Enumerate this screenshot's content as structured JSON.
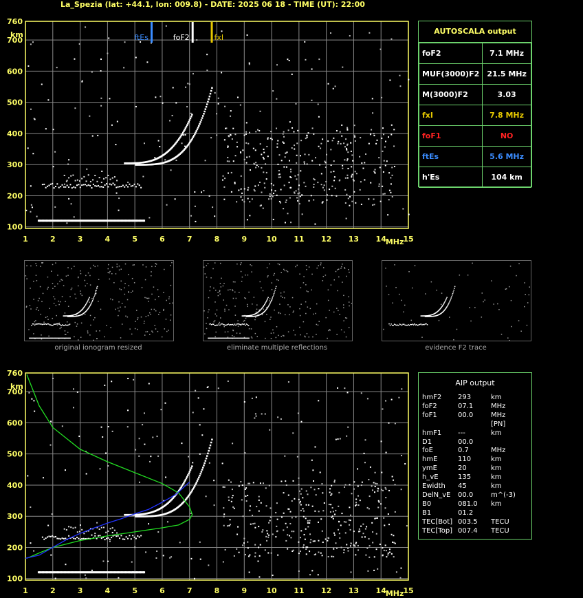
{
  "header": "La_Spezia (lat: +44.1, lon: 009.8) - DATE: 2025 06 18 - TIME (UT): 22:00",
  "colors": {
    "axis": "#ffff66",
    "grid": "#8a8a8a",
    "panel_border": "#6cd36c",
    "ftes": "#3a8cff",
    "fof2": "#ffffff",
    "fxi": "#e6c800",
    "profile_green": "#22dd22",
    "profile_blue": "#2233ff",
    "no": "#ff2222"
  },
  "chart_data": [
    {
      "type": "scatter",
      "title": "ionogram (AUTOSCALA)",
      "xlabel": "MHz",
      "ylabel": "km",
      "xlim": [
        1,
        15
      ],
      "ylim": [
        95,
        760
      ],
      "x_ticks": [
        "1",
        "2",
        "3",
        "4",
        "5",
        "6",
        "7",
        "8",
        "9",
        "10",
        "11",
        "12",
        "13",
        "14",
        "15"
      ],
      "y_ticks": [
        "760",
        "700",
        "600",
        "500",
        "400",
        "300",
        "200",
        "100"
      ],
      "markers": [
        {
          "name": "ftEs",
          "x": 5.6
        },
        {
          "name": "foF2",
          "x": 7.1
        },
        {
          "name": "fxI",
          "x": 7.8
        }
      ]
    },
    {
      "type": "line",
      "title": "ionogram (AIP)",
      "xlabel": "MHz",
      "ylabel": "km",
      "xlim": [
        1,
        15
      ],
      "ylim": [
        95,
        760
      ],
      "x_ticks": [
        "1",
        "2",
        "3",
        "4",
        "5",
        "6",
        "7",
        "8",
        "9",
        "10",
        "11",
        "12",
        "13",
        "14",
        "15"
      ],
      "y_ticks": [
        "760",
        "700",
        "600",
        "500",
        "400",
        "300",
        "200",
        "100"
      ],
      "series": [
        {
          "color": "#22dd22",
          "x": [
            1.05,
            1.5,
            2,
            3,
            4,
            5,
            6,
            6.6,
            7.0,
            7.1,
            7.0,
            6.6,
            6,
            5,
            4,
            3,
            2,
            1.5,
            1.05
          ],
          "y": [
            755,
            655,
            585,
            515,
            475,
            440,
            405,
            375,
            330,
            305,
            290,
            272,
            263,
            250,
            237,
            222,
            200,
            182,
            165
          ]
        },
        {
          "color": "#2233ff",
          "x": [
            1.0,
            1.5,
            2,
            2.5,
            3,
            3.5,
            4,
            4.5,
            5,
            5.5,
            6,
            6.5,
            7
          ],
          "y": [
            165,
            175,
            200,
            225,
            245,
            262,
            278,
            292,
            308,
            322,
            345,
            370,
            410
          ]
        }
      ]
    }
  ],
  "labels": {
    "x_unit": "MHz",
    "y_unit": "km",
    "ftes": "ftEs",
    "fof2": "foF2",
    "fxi": "fxI"
  },
  "autoscala": {
    "title": "AUTOSCALA output",
    "rows": [
      {
        "name": "foF2",
        "value": "7.1 MHz",
        "color": "#ffffff",
        "vcolor": "#ffffff"
      },
      {
        "name": "MUF(3000)F2",
        "value": "21.5 MHz",
        "color": "#ffffff",
        "vcolor": "#ffffff"
      },
      {
        "name": "M(3000)F2",
        "value": "3.03",
        "color": "#ffffff",
        "vcolor": "#ffffff"
      },
      {
        "name": "fxI",
        "value": "7.8 MHz",
        "color": "#e6c800",
        "vcolor": "#e6c800"
      },
      {
        "name": "foF1",
        "value": "NO",
        "color": "#ff2222",
        "vcolor": "#ff2222"
      },
      {
        "name": "ftEs",
        "value": "5.6 MHz",
        "color": "#3a8cff",
        "vcolor": "#3a8cff"
      },
      {
        "name": "h'Es",
        "value": "104     km",
        "color": "#ffffff",
        "vcolor": "#ffffff"
      }
    ]
  },
  "thumbnails": [
    {
      "label": "original ionogram resized"
    },
    {
      "label": "eliminate multiple reflections"
    },
    {
      "label": "evidence F2 trace"
    }
  ],
  "aip": {
    "title": "AIP output",
    "rows": [
      [
        "hmF2",
        "293",
        "km"
      ],
      [
        "foF2",
        "07.1",
        "MHz"
      ],
      [
        "foF1",
        "00.0",
        "MHz   [PN]"
      ],
      [
        "hmF1",
        "---",
        "km"
      ],
      [
        "D1",
        "00.0",
        ""
      ],
      [
        "foE",
        "0.7",
        "MHz"
      ],
      [
        "hmE",
        "110",
        "km"
      ],
      [
        "ymE",
        "20",
        "km"
      ],
      [
        "h_vE",
        "135",
        "km"
      ],
      [
        "Ewidth",
        "45",
        "km"
      ],
      [
        "DelN_vE",
        "00.0",
        "m^(-3)"
      ],
      [
        "B0",
        "081.0",
        "km"
      ],
      [
        "B1",
        "01.2",
        ""
      ],
      [
        "TEC[Bot]",
        "003.5",
        "TECU"
      ],
      [
        "TEC[Top]",
        "007.4",
        "TECU"
      ]
    ]
  }
}
